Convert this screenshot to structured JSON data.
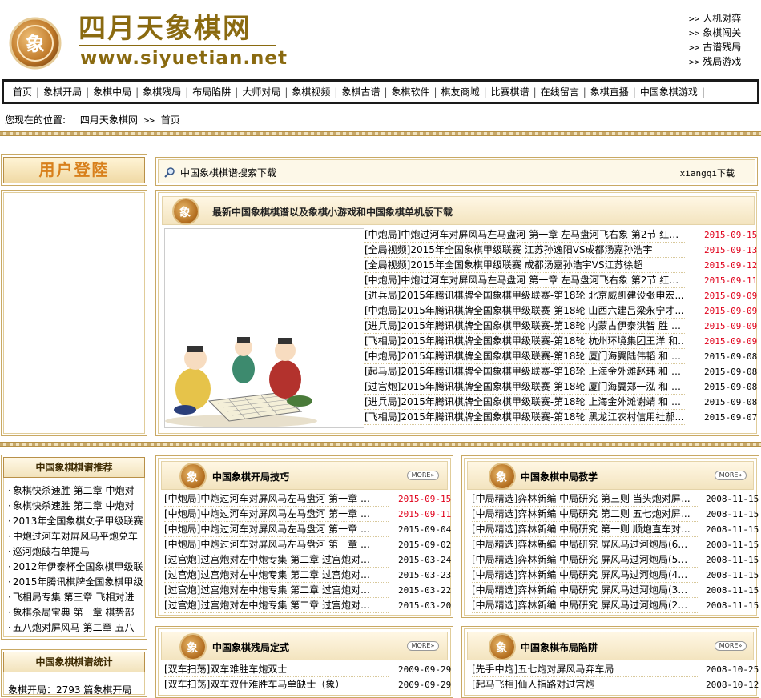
{
  "header": {
    "site_title": "四月天象棋网",
    "site_url": "www.siyuetian.net",
    "top_links": [
      "人机对弈",
      "象棋闯关",
      "古谱残局",
      "残局游戏"
    ]
  },
  "nav": [
    "首页",
    "象棋开局",
    "象棋中局",
    "象棋残局",
    "布局陷阱",
    "大师对局",
    "象棋视频",
    "象棋古谱",
    "象棋软件",
    "棋友商城",
    "比赛棋谱",
    "在线留言",
    "象棋直播",
    "中国象棋游戏"
  ],
  "breadcrumb": {
    "prefix": "您现在的位置:",
    "site": "四月天象棋网",
    "arrow": ">>",
    "current": "首页"
  },
  "login": {
    "title": "用户登陸"
  },
  "search_bar": {
    "text": "中国象棋棋谱搜索下载",
    "right": "xiangqi下载"
  },
  "latest": {
    "title": "最新中国象棋棋谱以及象棋小游戏和中国象棋单机版下载",
    "items": [
      {
        "tag": "[中炮局]",
        "text": "中炮过河车对屏风马左马盘河 第一章 左马盘河飞右象 第2节 红…",
        "date": "2015-09-15",
        "red": true
      },
      {
        "tag": "[全局视频]",
        "text": "2015年全国象棋甲级联赛 江苏孙逸阳VS成都汤嘉孙浩宇",
        "date": "2015-09-13",
        "red": true
      },
      {
        "tag": "[全局视频]",
        "text": "2015年全国象棋甲级联赛 成都汤嘉孙浩宇VS江苏徐超",
        "date": "2015-09-12",
        "red": true
      },
      {
        "tag": "[中炮局]",
        "text": "中炮过河车对屏风马左马盘河 第一章 左马盘河飞右象 第2节 红…",
        "date": "2015-09-11",
        "red": true
      },
      {
        "tag": "[进兵局]",
        "text": "2015年腾讯棋牌全国象棋甲级联赛-第18轮 北京威凯建设张申宏…",
        "date": "2015-09-09",
        "red": true
      },
      {
        "tag": "[中炮局]",
        "text": "2015年腾讯棋牌全国象棋甲级联赛-第18轮 山西六建吕梁永宁才…",
        "date": "2015-09-09",
        "red": true
      },
      {
        "tag": "[进兵局]",
        "text": "2015年腾讯棋牌全国象棋甲级联赛-第18轮 内蒙古伊泰洪智 胜 …",
        "date": "2015-09-09",
        "red": true
      },
      {
        "tag": "[飞相局]",
        "text": "2015年腾讯棋牌全国象棋甲级联赛-第18轮 杭州环境集团王洋 和…",
        "date": "2015-09-09",
        "red": true
      },
      {
        "tag": "[中炮局]",
        "text": "2015年腾讯棋牌全国象棋甲级联赛-第18轮 厦门海翼陆伟韬 和 …",
        "date": "2015-09-08",
        "red": false
      },
      {
        "tag": "[起马局]",
        "text": "2015年腾讯棋牌全国象棋甲级联赛-第18轮 上海金外滩赵玮 和 …",
        "date": "2015-09-08",
        "red": false
      },
      {
        "tag": "[过宫炮]",
        "text": "2015年腾讯棋牌全国象棋甲级联赛-第18轮 厦门海翼郑一泓 和 …",
        "date": "2015-09-08",
        "red": false
      },
      {
        "tag": "[进兵局]",
        "text": "2015年腾讯棋牌全国象棋甲级联赛-第18轮 上海金外滩谢靖 和 …",
        "date": "2015-09-08",
        "red": false
      },
      {
        "tag": "[飞相局]",
        "text": "2015年腾讯棋牌全国象棋甲级联赛-第18轮 黑龙江农村信用社郝…",
        "date": "2015-09-07",
        "red": false
      }
    ]
  },
  "recommend": {
    "title": "中国象棋棋谱推荐",
    "items": [
      "象棋快杀速胜 第二章 中炮对",
      "象棋快杀速胜 第二章 中炮对",
      "2013年全国象棋女子甲级联赛",
      "中炮过河车对屏风马平炮兑车",
      "巡河炮破右单提马",
      "2012年伊泰杯全国象棋甲级联",
      "2015年腾讯棋牌全国象棋甲级",
      "飞相局专集 第三章 飞相对进",
      "象棋杀局宝典 第一章 棋势部",
      "五八炮对屏风马 第二章 五八"
    ]
  },
  "stats": {
    "title": "中国象棋棋谱统计",
    "line": "象棋开局：2793 篇象棋开局"
  },
  "opening": {
    "title": "中国象棋开局技巧",
    "more": "MORE»",
    "items": [
      {
        "text": "[中炮局]中炮过河车对屏风马左马盘河 第一章 …",
        "date": "2015-09-15",
        "red": true
      },
      {
        "text": "[中炮局]中炮过河车对屏风马左马盘河 第一章 …",
        "date": "2015-09-11",
        "red": true
      },
      {
        "text": "[中炮局]中炮过河车对屏风马左马盘河 第一章 …",
        "date": "2015-09-04",
        "red": false
      },
      {
        "text": "[中炮局]中炮过河车对屏风马左马盘河 第一章 …",
        "date": "2015-09-02",
        "red": false
      },
      {
        "text": "[过宫炮]过宫炮对左中炮专集 第二章 过宫炮对…",
        "date": "2015-03-24",
        "red": false
      },
      {
        "text": "[过宫炮]过宫炮对左中炮专集 第二章 过宫炮对…",
        "date": "2015-03-23",
        "red": false
      },
      {
        "text": "[过宫炮]过宫炮对左中炮专集 第二章 过宫炮对…",
        "date": "2015-03-22",
        "red": false
      },
      {
        "text": "[过宫炮]过宫炮对左中炮专集 第二章 过宫炮对…",
        "date": "2015-03-20",
        "red": false
      }
    ]
  },
  "middle": {
    "title": "中国象棋中局教学",
    "more": "MORE»",
    "items": [
      {
        "text": "[中局精选]弈林新编 中局研究 第三则 当头炮对屏…",
        "date": "2008-11-15"
      },
      {
        "text": "[中局精选]弈林新编 中局研究 第二则 五七炮对屏…",
        "date": "2008-11-15"
      },
      {
        "text": "[中局精选]弈林新编 中局研究 第一则 顺炮直车对…",
        "date": "2008-11-15"
      },
      {
        "text": "[中局精选]弈林新编 中局研究 屏风马过河炮局(6…",
        "date": "2008-11-15"
      },
      {
        "text": "[中局精选]弈林新编 中局研究 屏风马过河炮局(5…",
        "date": "2008-11-15"
      },
      {
        "text": "[中局精选]弈林新编 中局研究 屏风马过河炮局(4…",
        "date": "2008-11-15"
      },
      {
        "text": "[中局精选]弈林新编 中局研究 屏风马过河炮局(3…",
        "date": "2008-11-15"
      },
      {
        "text": "[中局精选]弈林新编 中局研究 屏风马过河炮局(2…",
        "date": "2008-11-15"
      }
    ]
  },
  "endgame": {
    "title": "中国象棋残局定式",
    "more": "MORE»",
    "items": [
      {
        "text": "[双车扫荡]双车难胜车炮双士",
        "date": "2009-09-29"
      },
      {
        "text": "[双车扫荡]双车双仕难胜车马单缺士（象）",
        "date": "2009-09-29"
      }
    ]
  },
  "traps": {
    "title": "中国象棋布局陷阱",
    "more": "MORE»",
    "items": [
      {
        "text": "[先手中炮]五七炮对屏风马弃车局",
        "date": "2008-10-25"
      },
      {
        "text": "[起马飞相]仙人指路对过宫炮",
        "date": "2008-10-12"
      }
    ]
  }
}
